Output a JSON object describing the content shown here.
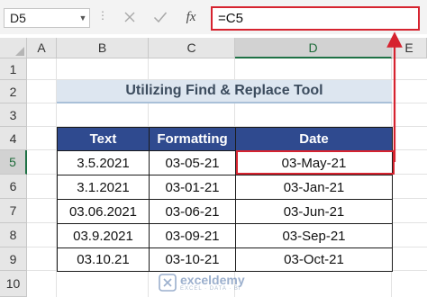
{
  "formula_bar": {
    "name_box": "D5",
    "cancel_icon": "close-icon",
    "enter_icon": "check-icon",
    "fx_label": "fx",
    "formula": "=C5"
  },
  "columns": [
    "A",
    "B",
    "C",
    "D",
    "E"
  ],
  "rows": [
    "1",
    "2",
    "3",
    "4",
    "5",
    "6",
    "7",
    "8",
    "9",
    "10"
  ],
  "selected_cell": {
    "column": "D",
    "row": "5"
  },
  "title": "Utilizing Find & Replace Tool",
  "table": {
    "headers": [
      "Text",
      "Formatting",
      "Date"
    ],
    "rows": [
      [
        "3.5.2021",
        "03-05-21",
        "03-May-21"
      ],
      [
        "3.1.2021",
        "03-01-21",
        "03-Jan-21"
      ],
      [
        "03.06.2021",
        "03-06-21",
        "03-Jun-21"
      ],
      [
        "03.9.2021",
        "03-09-21",
        "03-Sep-21"
      ],
      [
        "03.10.21",
        "03-10-21",
        "03-Oct-21"
      ]
    ]
  },
  "highlight_color": "#d6232f",
  "header_fill_color": "#2f4a8f",
  "watermark": {
    "name": "exceldemy",
    "tagline": "EXCEL · DATA · BI"
  }
}
